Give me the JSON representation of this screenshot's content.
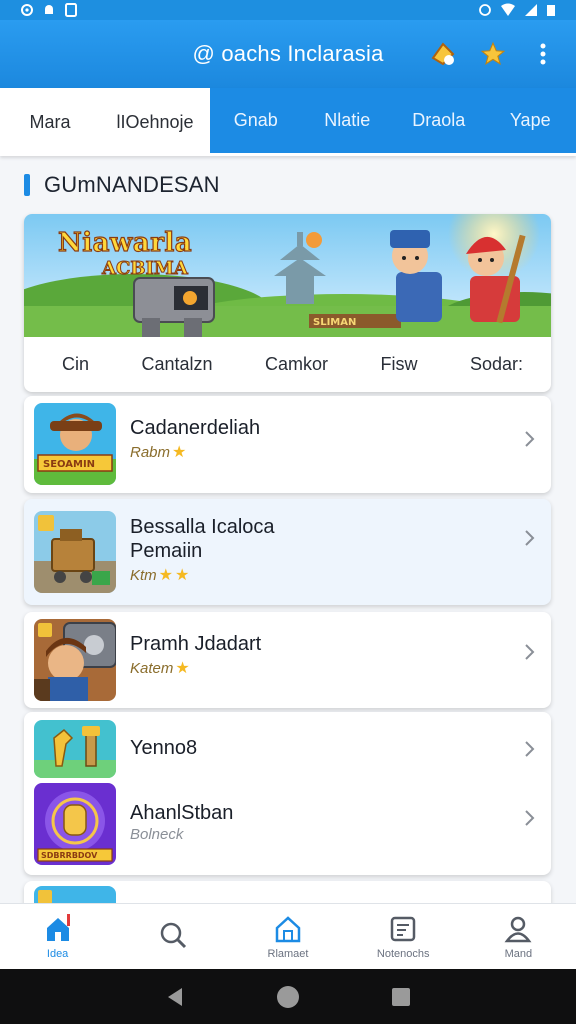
{
  "status_bar": {
    "left_icons": [
      "settings-icon",
      "notification-icon",
      "sim-icon"
    ],
    "right_icons": [
      "alarm-icon",
      "wifi-icon",
      "signal-icon",
      "battery-icon"
    ]
  },
  "app_bar": {
    "title": "@ oachs Inclarasia",
    "actions": [
      "coin-icon",
      "star-icon",
      "more-vert-icon"
    ]
  },
  "tabs": [
    "Mara",
    "lIOehnoje",
    "Gnab",
    "Nlatie",
    "Draola",
    "Yape"
  ],
  "section": {
    "title": "GUmNANDESAN"
  },
  "banner": {
    "title": "Niawarla",
    "subtitle": "ACBIMA",
    "sign_text": "SLIMAN",
    "tabs": [
      "Cin",
      "Cantalzn",
      "Camkor",
      "Fisw",
      "Sodar:"
    ]
  },
  "items": [
    {
      "title": "Cadanerdeliah",
      "rating": "Rabm",
      "stars": 1
    },
    {
      "title": "Bessalla Icaloca",
      "title2": "Pemaiin",
      "rating": "Ktm",
      "stars": 2
    },
    {
      "title": "Pramh Jdadart",
      "rating": "Katem",
      "stars": 1
    },
    {
      "title": "Yenno8",
      "thumb_alt_title": "AhanlStban",
      "rating2": "Bolneck"
    }
  ],
  "thumb_text": {
    "first": "SEOAMIN",
    "last": "SDBRRBDOV"
  },
  "bottom_nav": [
    {
      "label": "Idea",
      "icon": "home-icon",
      "active": true
    },
    {
      "label": "",
      "icon": "search-icon",
      "active": false
    },
    {
      "label": "Rlamaet",
      "icon": "shop-icon",
      "active": false
    },
    {
      "label": "Notenochs",
      "icon": "notes-icon",
      "active": false
    },
    {
      "label": "Mand",
      "icon": "profile-icon",
      "active": false
    }
  ],
  "colors": {
    "primary": "#1c8be4",
    "star": "#f5b922",
    "background": "#f4f6f9"
  }
}
